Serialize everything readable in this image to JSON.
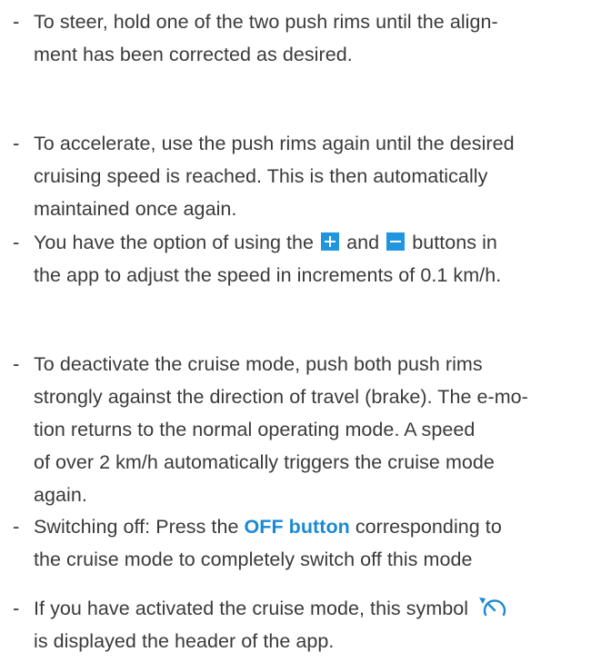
{
  "items": [
    {
      "dash": "-",
      "lines": [
        "To steer, hold one of the two push rims until the align-",
        "ment has been corrected as desired."
      ]
    },
    {
      "dash": "-",
      "lines": [
        "To accelerate, use the push rims again until the desired",
        "cruising speed is reached. This is then automatically",
        "maintained once again."
      ]
    },
    {
      "dash": "-",
      "line1_a": "You have the option of using the",
      "line1_and": "and",
      "line1_b": "buttons in",
      "line2": "the app to adjust the speed in increments of 0.1 km/h.",
      "plus_icon": "plus-button-icon",
      "minus_icon": "minus-button-icon"
    },
    {
      "dash": "-",
      "lines": [
        "To deactivate the cruise mode, push both push rims",
        "strongly against the direction of travel (brake). The e-mo-",
        "tion returns to the normal operating mode. A speed",
        "of over 2 km/h automatically triggers the cruise mode",
        "again."
      ]
    },
    {
      "dash": "-",
      "line1_a": "Switching off: Press the",
      "line1_strong": "OFF button",
      "line1_b": "corresponding to",
      "line2": "the cruise mode to completely switch off this mode"
    },
    {
      "dash": "-",
      "line1": "If you have activated the cruise mode, this symbol",
      "line2": "is displayed the header of the app.",
      "symbol_icon": "cruise-mode-icon"
    }
  ],
  "colors": {
    "text": "#3a3a3a",
    "accent": "#1a8ad4",
    "button_bg": "#2196e0"
  }
}
